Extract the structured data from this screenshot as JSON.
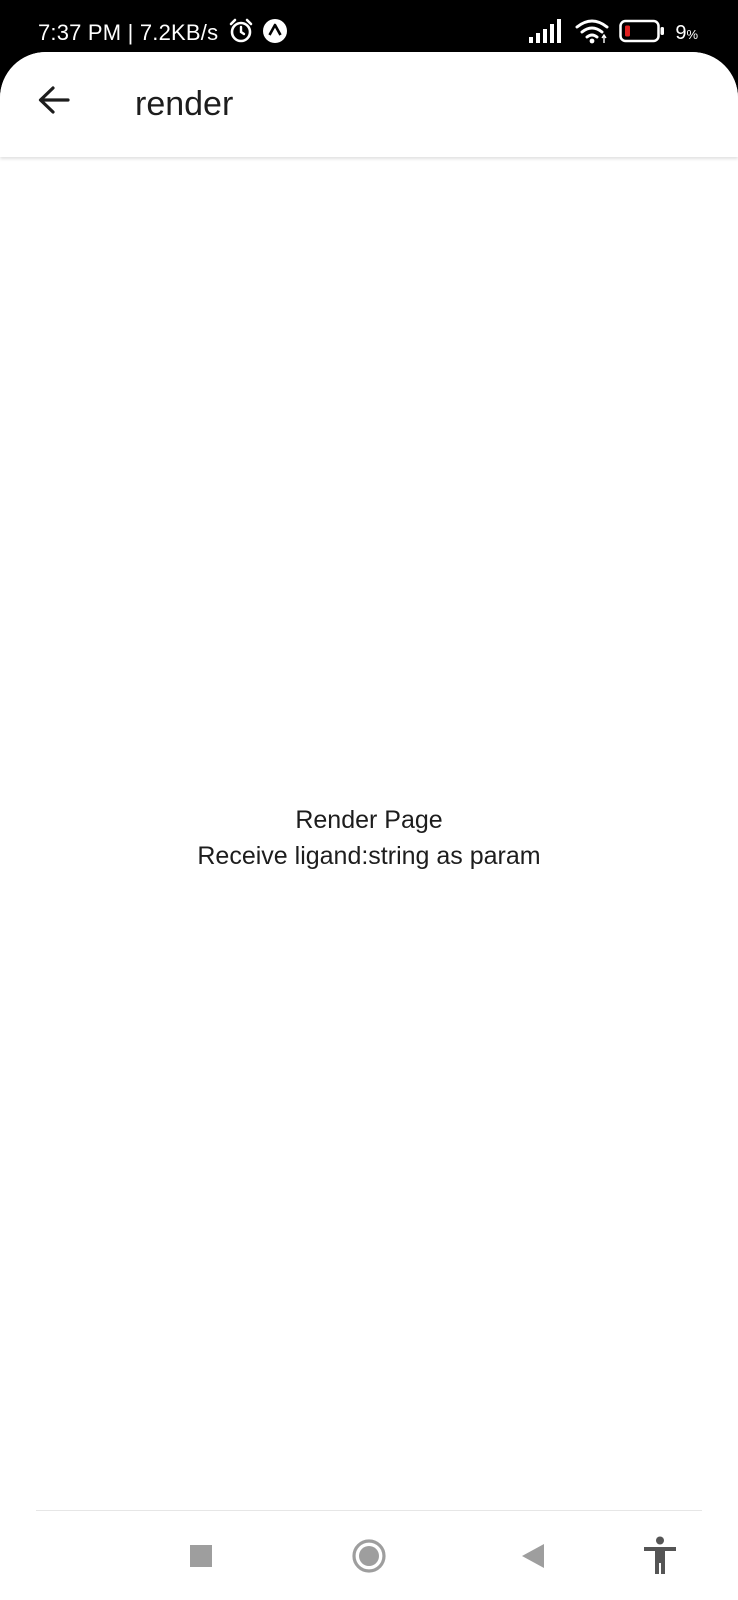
{
  "status_bar": {
    "time_speed": "7:37 PM | 7.2KB/s",
    "battery_percent": "9",
    "battery_unit": "%"
  },
  "app_bar": {
    "title": "render"
  },
  "content": {
    "line1": "Render Page",
    "line2": "Receive ligand:string as param"
  },
  "icons": {
    "back": "arrow-left-icon",
    "alarm": "alarm-clock-icon",
    "app_notification": "caret-up-circle-icon",
    "signal": "cell-signal-icon",
    "wifi": "wifi-icon",
    "battery": "battery-icon",
    "nav_recent": "square-icon",
    "nav_home": "circle-icon",
    "nav_back": "triangle-back-icon",
    "accessibility": "accessibility-icon"
  },
  "colors": {
    "status_bar_bg": "#000000",
    "app_bg": "#ffffff",
    "text": "#1d1d1d",
    "battery_low": "#e02020",
    "nav_icon": "#9e9e9e"
  }
}
